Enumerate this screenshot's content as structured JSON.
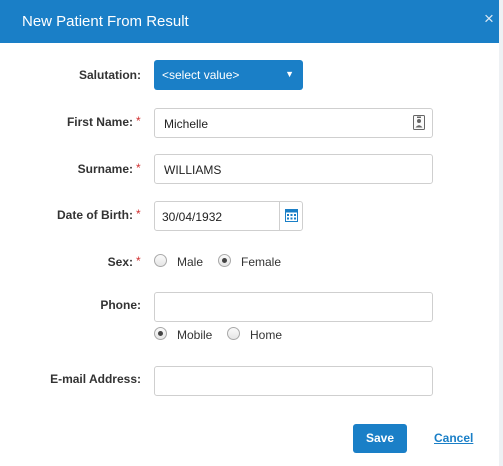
{
  "dialog": {
    "title": "New Patient From Result",
    "close_symbol": "×"
  },
  "form": {
    "salutation": {
      "label": "Salutation:",
      "value": "<select value>"
    },
    "first_name": {
      "label": "First Name:",
      "value": "Michelle"
    },
    "surname": {
      "label": "Surname:",
      "value": "WILLIAMS"
    },
    "dob": {
      "label": "Date of Birth:",
      "value": "30/04/1932"
    },
    "sex": {
      "label": "Sex:",
      "options": [
        {
          "label": "Male",
          "checked": false
        },
        {
          "label": "Female",
          "checked": true
        }
      ]
    },
    "phone": {
      "label": "Phone:",
      "value": "",
      "type_options": [
        {
          "label": "Mobile",
          "checked": true
        },
        {
          "label": "Home",
          "checked": false
        }
      ]
    },
    "email": {
      "label": "E-mail Address:",
      "value": ""
    },
    "required_marker": "*"
  },
  "actions": {
    "save": "Save",
    "cancel": "Cancel"
  },
  "colors": {
    "accent": "#1a7fc7",
    "required": "#d03030"
  },
  "icons": {
    "contact": "contact-card-icon",
    "calendar": "calendar-icon",
    "dropdown": "chevron-down-icon"
  }
}
